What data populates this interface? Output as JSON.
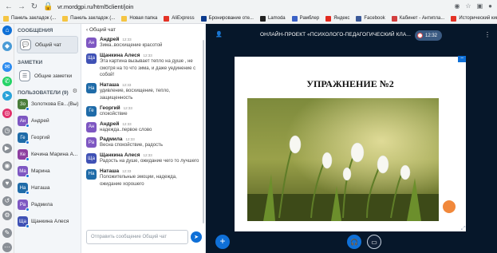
{
  "browser": {
    "url": "vr.mordgpi.ru/html5client/join",
    "bookmarks": [
      {
        "label": "Панель закладок (...",
        "color": "#f5c542"
      },
      {
        "label": "Панель закладок (...",
        "color": "#f5c542"
      },
      {
        "label": "Новая папка",
        "color": "#f5c542"
      },
      {
        "label": "AliExpress",
        "color": "#e43225"
      },
      {
        "label": "Бронирование оте...",
        "color": "#0b3a8d"
      },
      {
        "label": "Lamoda",
        "color": "#222222"
      },
      {
        "label": "Рамблер",
        "color": "#3b61c6"
      },
      {
        "label": "Яндекс",
        "color": "#e22a1f"
      },
      {
        "label": "Facebook",
        "color": "#3b5998"
      },
      {
        "label": "Кабинет - Антипла...",
        "color": "#d23e3e"
      },
      {
        "label": "Исторический кино...",
        "color": "#e43225"
      }
    ]
  },
  "sidebar": {
    "messages_title": "СООБЩЕНИЯ",
    "public_chat": "Общий чат",
    "notes_title": "ЗАМЕТКИ",
    "shared_notes": "Общие заметки",
    "users_title": "ПОЛЬЗОВАТЕЛИ (9)",
    "users": [
      {
        "initials": "Зо",
        "name": "Золоткова Ев...(Вы)",
        "color": "#4a7d3a"
      },
      {
        "initials": "Ан",
        "name": "Андрей",
        "color": "#7e57c2"
      },
      {
        "initials": "Ге",
        "name": "Георгий",
        "color": "#1f6ba8"
      },
      {
        "initials": "Ке",
        "name": "Кечина Марина А...",
        "color": "#8e3fa0"
      },
      {
        "initials": "Ма",
        "name": "Марина",
        "color": "#7e57c2"
      },
      {
        "initials": "На",
        "name": "Наташа",
        "color": "#1f6ba8"
      },
      {
        "initials": "Ра",
        "name": "Радмила",
        "color": "#7e57c2"
      },
      {
        "initials": "Ща",
        "name": "Щанкина Алеся",
        "color": "#3f51b5"
      }
    ]
  },
  "chat": {
    "back_label": "‹  Общий чат",
    "messages": [
      {
        "initials": "Ан",
        "color": "#7e57c2",
        "name": "Андрей",
        "time": "12:33",
        "text": "Зима..восхищение красотой"
      },
      {
        "initials": "Ща",
        "color": "#3f51b5",
        "name": "Щанкина Алеся",
        "time": "12:33",
        "text": "Эта картина вызывает тепло на душе , не смотря на то что зима, и даже уединение с собой!"
      },
      {
        "initials": "На",
        "color": "#1f6ba8",
        "name": "Наташа",
        "time": "12:33",
        "text": "удивление, восхищение, тепло, защищенность"
      },
      {
        "initials": "Ге",
        "color": "#1f6ba8",
        "name": "Георгий",
        "time": "12:33",
        "text": "спокойствие"
      },
      {
        "initials": "Ан",
        "color": "#7e57c2",
        "name": "Андрей",
        "time": "12:33",
        "text": "надежда..первое слово"
      },
      {
        "initials": "Ра",
        "color": "#7e57c2",
        "name": "Радмила",
        "time": "12:33",
        "text": "Весна спокойствие, радость"
      },
      {
        "initials": "Ща",
        "color": "#3f51b5",
        "name": "Щанкина Алеся",
        "time": "12:33",
        "text": "Радость на душе, ожидание чего то лучшего"
      },
      {
        "initials": "На",
        "color": "#1f6ba8",
        "name": "Наташа",
        "time": "12:33",
        "text": "Положительные эмоции, надежда, ожидание хорошего"
      }
    ],
    "composer_placeholder": "Отправить сообщение Общий чат"
  },
  "presentation": {
    "title": "ОНЛАЙН-ПРОЕКТ «ПСИХОЛОГО-ПЕДАГОГИЧЕСКИЙ КЛА...",
    "recording_time": "12:32",
    "slide_heading": "УПРАЖНЕНИЕ №2"
  },
  "colors": {
    "accent": "#0f70d7",
    "stage": "#06172a",
    "orange": "#f1883b"
  }
}
